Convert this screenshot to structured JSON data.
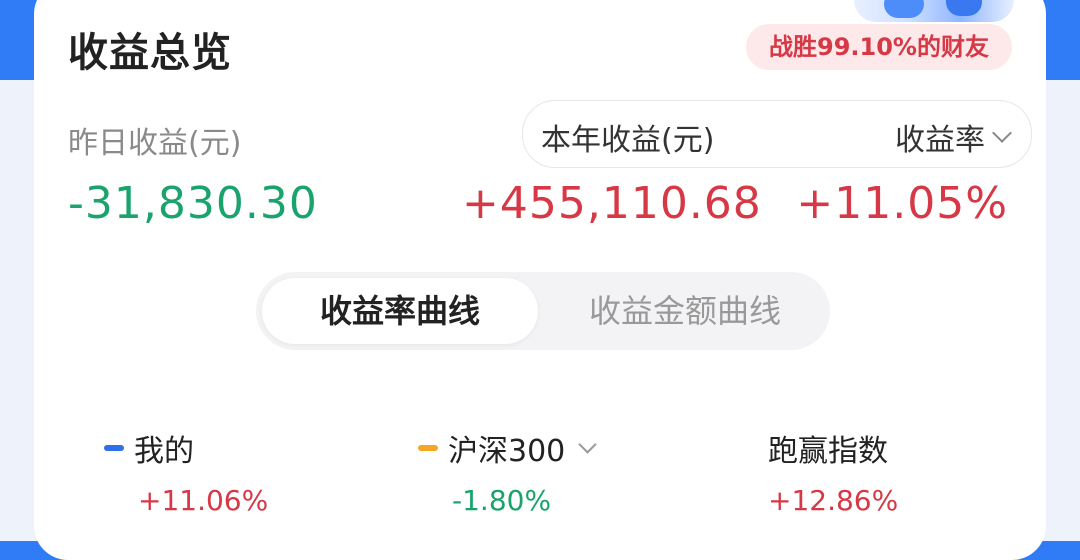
{
  "card": {
    "title": "收益总览",
    "badge": "战胜99.10%的财友"
  },
  "yesterday": {
    "label": "昨日收益(元)",
    "value": "-31,830.30"
  },
  "year": {
    "label": "本年收益(元)",
    "value": "+455,110.68"
  },
  "rate": {
    "dropdown_label": "收益率",
    "value": "+11.05%"
  },
  "tabs": [
    {
      "label": "收益率曲线",
      "selected": true
    },
    {
      "label": "收益金额曲线",
      "selected": false
    }
  ],
  "legend": [
    {
      "name": "我的",
      "value": "+11.06%",
      "color": "#2f6fe8"
    },
    {
      "name": "沪深300",
      "value": "-1.80%",
      "color": "#f5a623"
    },
    {
      "name": "跑赢指数",
      "value": "+12.86%"
    }
  ],
  "colors": {
    "positive": "#d63845",
    "negative": "#1aa36c",
    "brand": "#2f7cf6"
  }
}
